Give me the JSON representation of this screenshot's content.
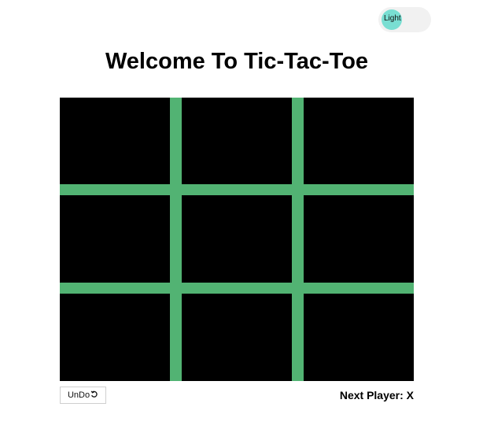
{
  "theme_toggle": {
    "label": "Light",
    "knob_color": "#79ded2"
  },
  "title": "Welcome To Tic-Tac-Toe",
  "board": {
    "grid_color": "#52b373",
    "cell_color": "#000000",
    "cells": [
      [
        "",
        "",
        ""
      ],
      [
        "",
        "",
        ""
      ],
      [
        "",
        "",
        ""
      ]
    ]
  },
  "controls": {
    "undo_label": "UnDo",
    "undo_icon": "undo-icon"
  },
  "status": {
    "label": "Next Player:",
    "player": "X"
  }
}
